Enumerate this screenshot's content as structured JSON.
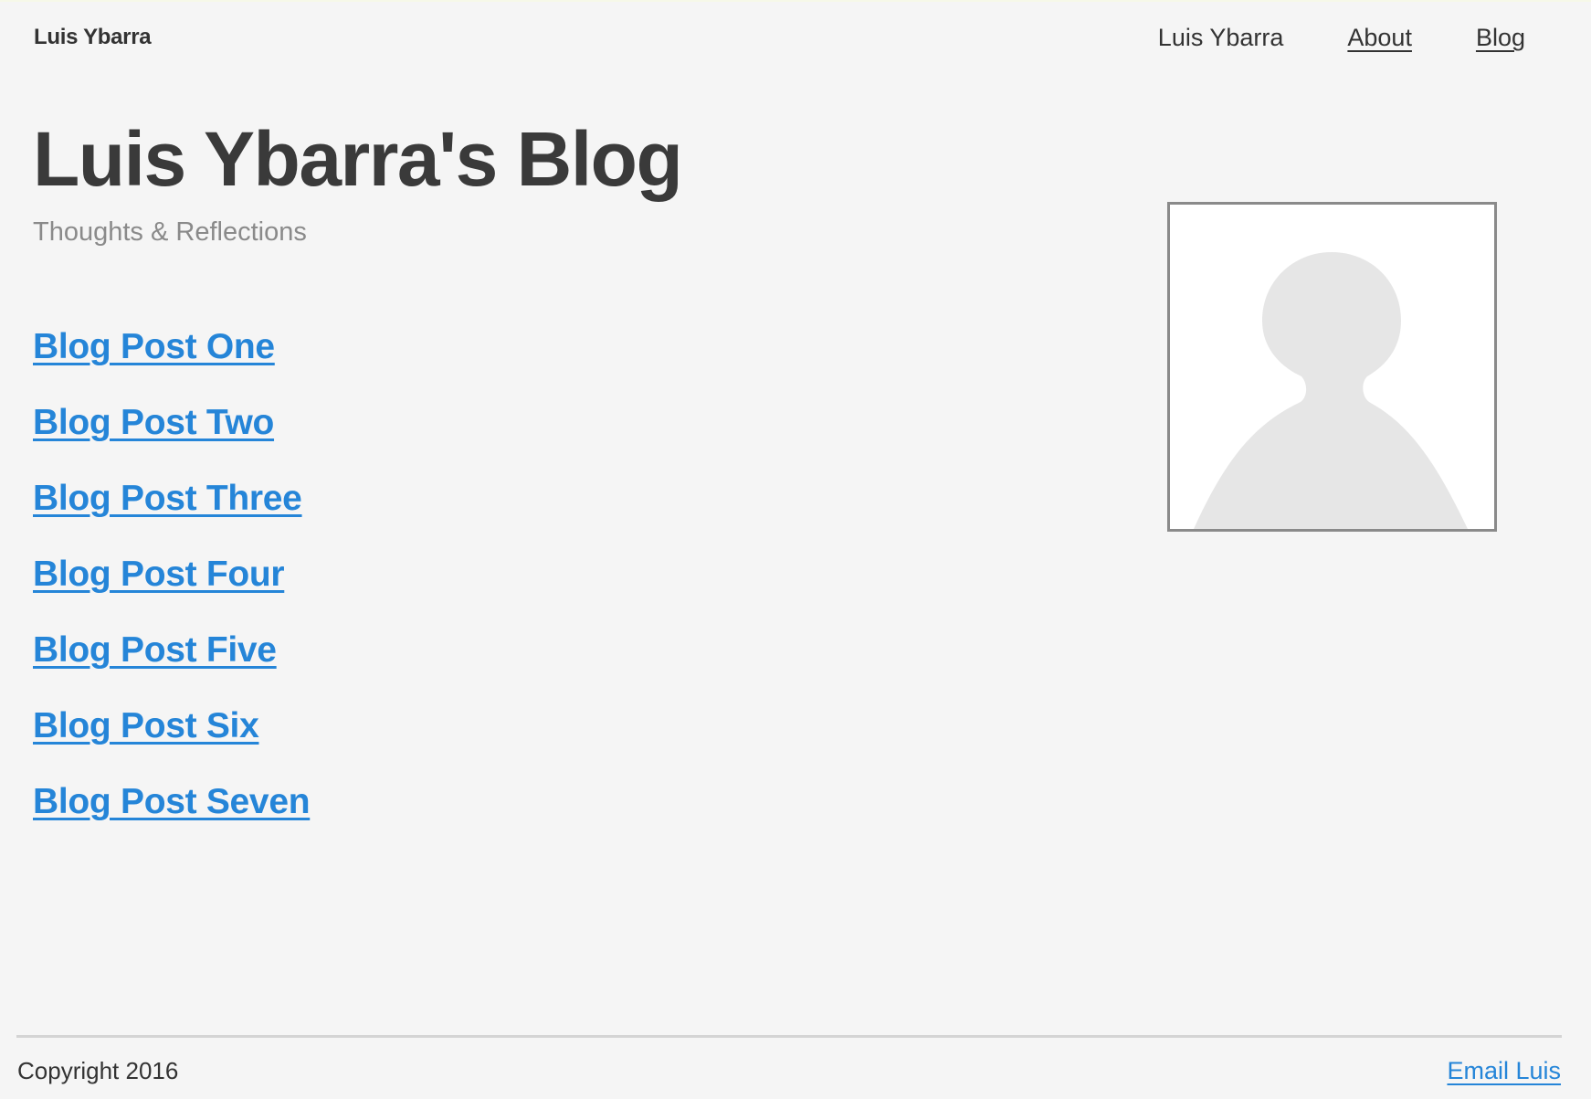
{
  "header": {
    "site_name": "Luis Ybarra",
    "nav": [
      {
        "label": "Luis Ybarra"
      },
      {
        "label": "About"
      },
      {
        "label": "Blog"
      }
    ]
  },
  "main": {
    "title": "Luis Ybarra's Blog",
    "subtitle": "Thoughts & Reflections",
    "posts": [
      {
        "label": "Blog Post One"
      },
      {
        "label": "Blog Post Two"
      },
      {
        "label": "Blog Post Three"
      },
      {
        "label": "Blog Post Four"
      },
      {
        "label": "Blog Post Five"
      },
      {
        "label": "Blog Post Six"
      },
      {
        "label": "Blog Post Seven"
      }
    ],
    "avatar_icon": "person-silhouette-icon"
  },
  "footer": {
    "copyright": "Copyright 2016",
    "email_label": "Email Luis"
  },
  "colors": {
    "background": "#f5f5f5",
    "link": "#2585d8",
    "text": "#3a3a3a",
    "muted": "#8a8a8a"
  }
}
